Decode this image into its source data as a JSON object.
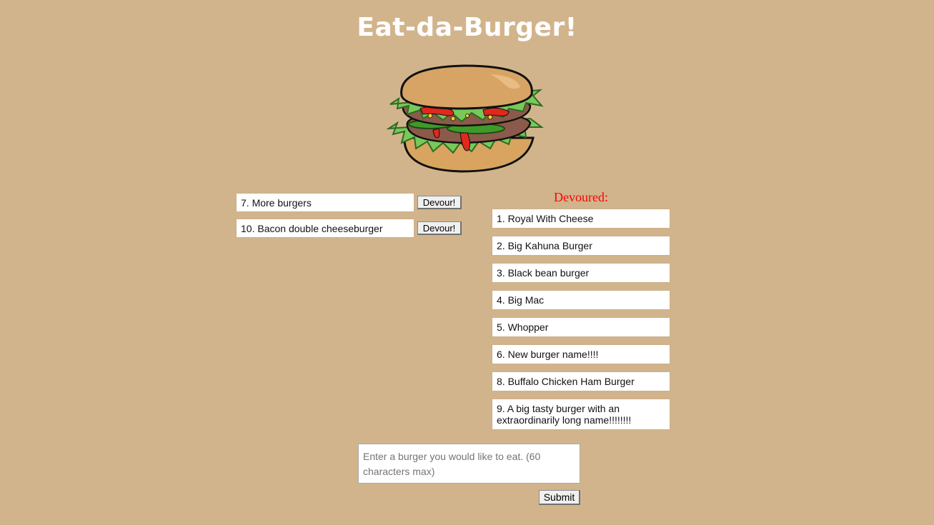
{
  "page": {
    "title": "Eat-da-Burger!"
  },
  "image": {
    "name": "burger-icon"
  },
  "uneaten": {
    "button_label": "Devour!",
    "items": [
      {
        "label": "7. More burgers"
      },
      {
        "label": "10. Bacon double cheeseburger"
      }
    ]
  },
  "devoured": {
    "heading": "Devoured:",
    "items": [
      {
        "label": "1. Royal With Cheese"
      },
      {
        "label": "2. Big Kahuna Burger"
      },
      {
        "label": "3. Black bean burger"
      },
      {
        "label": "4. Big Mac"
      },
      {
        "label": "5. Whopper"
      },
      {
        "label": "6. New burger name!!!!"
      },
      {
        "label": "8. Buffalo Chicken Ham Burger"
      },
      {
        "label": "9. A big tasty burger with an extraordinarily long name!!!!!!!!"
      }
    ]
  },
  "form": {
    "placeholder": "Enter a burger you would like to eat. (60 characters max)",
    "submit_label": "Submit"
  },
  "colors": {
    "background": "#d2b48c",
    "title": "#ffffff",
    "devoured_heading": "#ff0000"
  }
}
